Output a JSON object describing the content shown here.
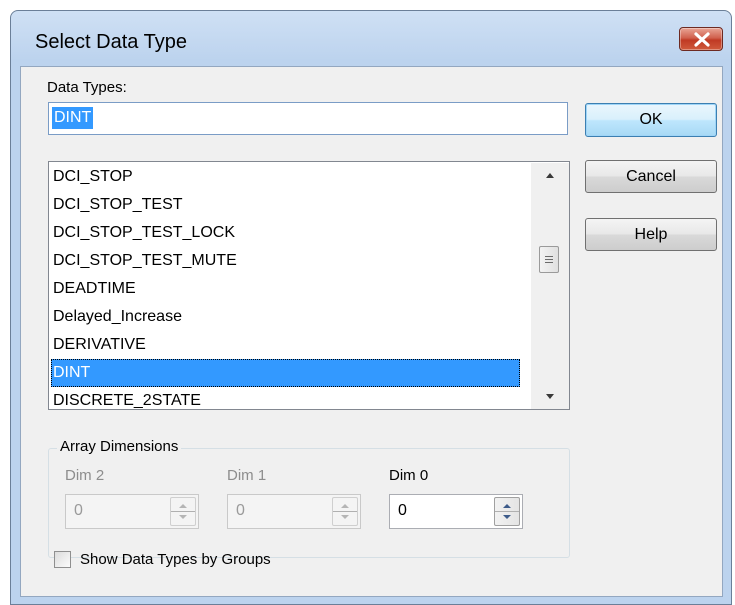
{
  "window": {
    "title": "Select Data Type"
  },
  "data_types": {
    "label": "Data Types:",
    "value": "DINT"
  },
  "list": {
    "items": [
      "DCI_STOP",
      "DCI_STOP_TEST",
      "DCI_STOP_TEST_LOCK",
      "DCI_STOP_TEST_MUTE",
      "DEADTIME",
      "Delayed_Increase",
      "DERIVATIVE",
      "DINT",
      "DISCRETE_2STATE"
    ],
    "selected": "DINT"
  },
  "buttons": {
    "ok": "OK",
    "cancel": "Cancel",
    "help": "Help"
  },
  "array_dimensions": {
    "label": "Array Dimensions",
    "dims": [
      {
        "label": "Dim 2",
        "value": "0",
        "enabled": false
      },
      {
        "label": "Dim 1",
        "value": "0",
        "enabled": false
      },
      {
        "label": "Dim 0",
        "value": "0",
        "enabled": true
      }
    ]
  },
  "show_groups": {
    "label": "Show Data Types by Groups",
    "checked": false
  },
  "colors": {
    "selection": "#3399ff",
    "dialog_bg": "#f0f0f0",
    "frame": "#bcd3ee"
  }
}
